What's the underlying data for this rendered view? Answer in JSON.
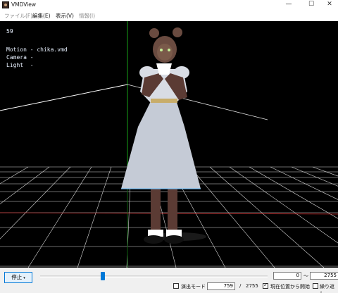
{
  "window": {
    "title": "VMDView"
  },
  "menu": [
    {
      "label": "ファイル(F)",
      "disabled": true
    },
    {
      "label": "編集(E)",
      "disabled": false
    },
    {
      "label": "表示(V)",
      "disabled": false
    },
    {
      "label": "情報(I)",
      "disabled": true
    }
  ],
  "overlay": {
    "fps": "59",
    "motion": "Motion - chika.vmd",
    "camera": "Camera -",
    "light": "Light  -"
  },
  "controls": {
    "stop_label": "停止",
    "range_start": "0",
    "tilde": "～",
    "range_end": "2755",
    "speed_mode_label": "演出モード",
    "speed_mode_checked": false,
    "current_frame": "759",
    "slash": "/",
    "total_frames": "2755",
    "play_from_current_label": "現在位置から開始",
    "play_from_current_checked": true,
    "loop_label": "繰り返し",
    "loop_checked": false,
    "slider_progress": 0.2755
  },
  "colors": {
    "viewport_bg": "#000000",
    "grid_line": "#ffffff",
    "axis_green": "#17a017",
    "axis_red": "#e02020",
    "accent": "#0078d7"
  }
}
